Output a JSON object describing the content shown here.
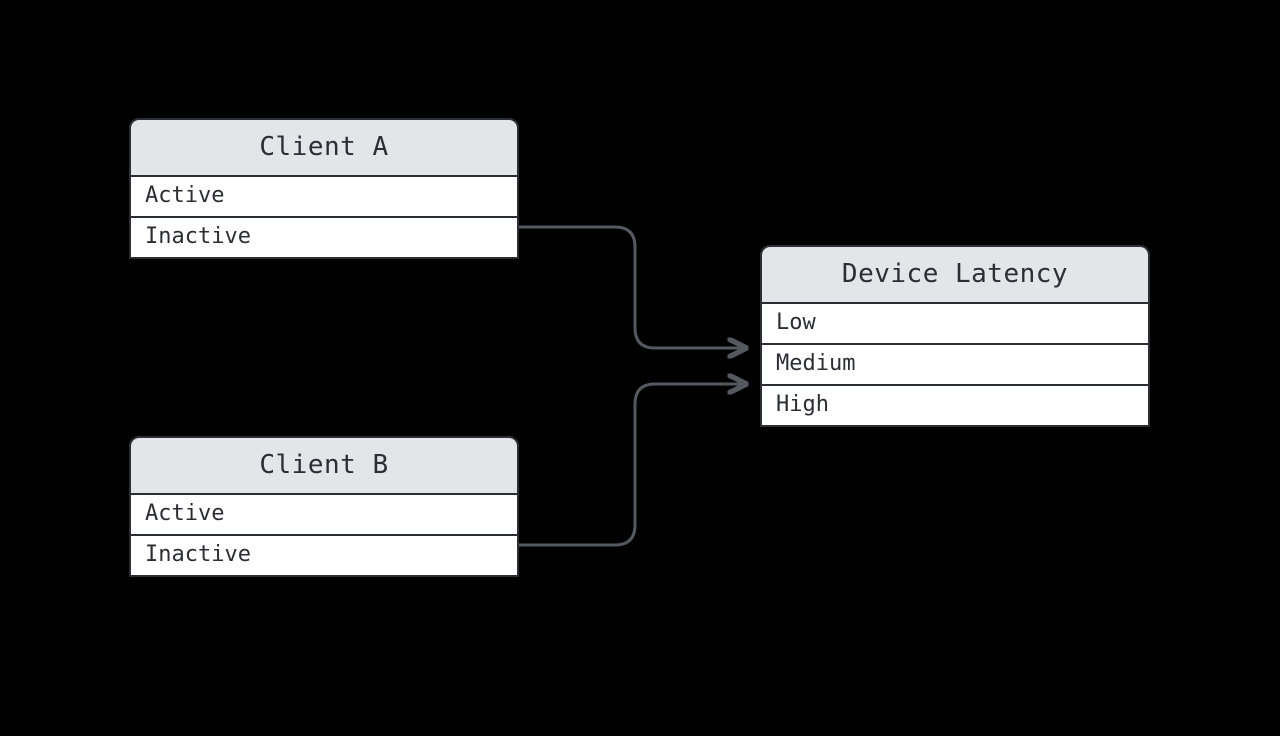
{
  "entities": {
    "clientA": {
      "title": "Client A",
      "rows": [
        "Active",
        "Inactive"
      ]
    },
    "clientB": {
      "title": "Client B",
      "rows": [
        "Active",
        "Inactive"
      ]
    },
    "deviceLatency": {
      "title": "Device Latency",
      "rows": [
        "Low",
        "Medium",
        "High"
      ]
    }
  },
  "connections": [
    {
      "from": "clientA",
      "to": "deviceLatency"
    },
    {
      "from": "clientB",
      "to": "deviceLatency"
    }
  ]
}
